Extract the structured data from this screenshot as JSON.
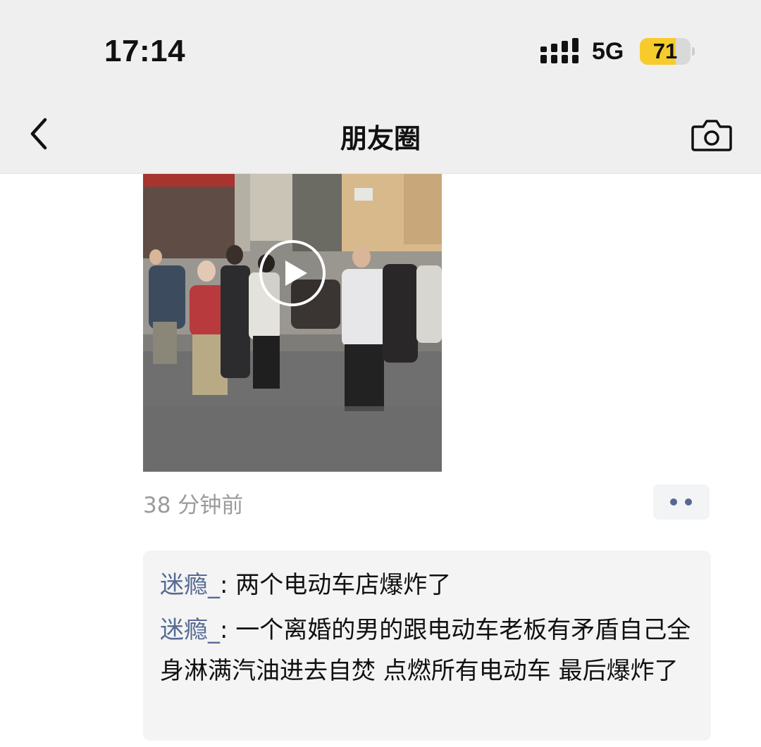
{
  "status_bar": {
    "time": "17:14",
    "network": "5G",
    "battery_level": "71",
    "battery_fraction": 0.71,
    "battery_color": "#f7cb2c"
  },
  "nav": {
    "title": "朋友圈",
    "back_icon": "chevron-left-icon",
    "camera_icon": "camera-icon"
  },
  "post": {
    "media_type": "video",
    "play_icon": "play-icon",
    "timestamp": "38 分钟前",
    "more_icon": "more-dots-icon"
  },
  "comments": [
    {
      "author": "迷瘾_",
      "separator": ": ",
      "text": "两个电动车店爆炸了"
    },
    {
      "author": "迷瘾_",
      "separator": ": ",
      "text": "一个离婚的男的跟电动车老板有矛盾自己全身淋满汽油进去自焚 点燃所有电动车 最后爆炸了"
    }
  ],
  "colors": {
    "link": "#576b95",
    "header_bg": "#efefef",
    "timestamp": "#9b9b9b",
    "comment_bg": "#f4f4f4"
  }
}
